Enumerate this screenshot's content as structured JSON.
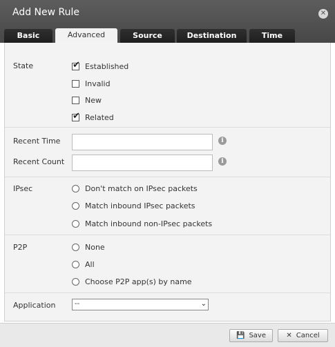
{
  "dialog": {
    "title": "Add New Rule",
    "close_label": "✕"
  },
  "tabs": [
    {
      "label": "Basic",
      "active": false
    },
    {
      "label": "Advanced",
      "active": true
    },
    {
      "label": "Source",
      "active": false
    },
    {
      "label": "Destination",
      "active": false
    },
    {
      "label": "Time",
      "active": false
    }
  ],
  "state": {
    "label": "State",
    "options": [
      {
        "label": "Established",
        "checked": true
      },
      {
        "label": "Invalid",
        "checked": false
      },
      {
        "label": "New",
        "checked": false
      },
      {
        "label": "Related",
        "checked": true
      }
    ]
  },
  "recent_time": {
    "label": "Recent Time",
    "value": "",
    "info_icon": "i"
  },
  "recent_count": {
    "label": "Recent Count",
    "value": "",
    "info_icon": "i"
  },
  "ipsec": {
    "label": "IPsec",
    "options": [
      {
        "label": "Don't match on IPsec packets",
        "selected": false
      },
      {
        "label": "Match inbound IPsec packets",
        "selected": false
      },
      {
        "label": "Match inbound non-IPsec packets",
        "selected": false
      }
    ]
  },
  "p2p": {
    "label": "P2P",
    "options": [
      {
        "label": "None",
        "selected": false
      },
      {
        "label": "All",
        "selected": false
      },
      {
        "label": "Choose P2P app(s) by name",
        "selected": false
      }
    ]
  },
  "application": {
    "label": "Application",
    "value": "--",
    "arrow": "⌄"
  },
  "footer": {
    "save_label": "Save",
    "save_icon": "💾",
    "cancel_label": "Cancel",
    "cancel_icon": "✕"
  }
}
